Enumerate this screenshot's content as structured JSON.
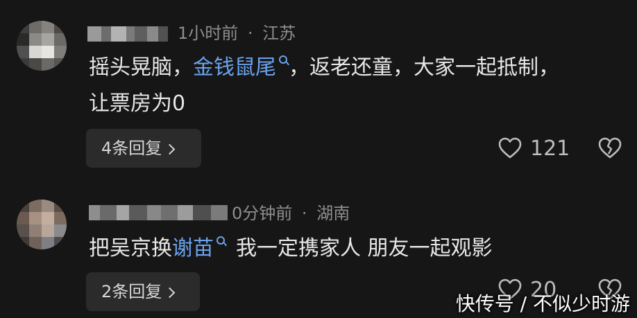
{
  "comments": [
    {
      "time": "1小时前",
      "separator": "·",
      "location": "江苏",
      "text_before_link": "摇头晃脑，",
      "link": "金钱鼠尾",
      "text_after_link": "，返老还童，大家一起抵制，",
      "line2": "让票房为0",
      "replies": "4条回复",
      "likes": "121"
    },
    {
      "time": "0分钟前",
      "separator": "·",
      "location": "湖南",
      "text_before_link": "把吴京换",
      "link": "谢苗",
      "text_after_link": "我一定携家人 朋友一起观影",
      "replies": "2条回复",
      "likes": "20"
    }
  ],
  "watermark": "快传号 / 不似少时游",
  "colors": {
    "background": "#161616",
    "link": "#6aa3ee",
    "meta": "#8e8e8e",
    "button_bg": "#2b2b2b"
  },
  "icons": [
    "search-icon",
    "chevron-right-icon",
    "heart-icon",
    "broken-heart-icon"
  ]
}
